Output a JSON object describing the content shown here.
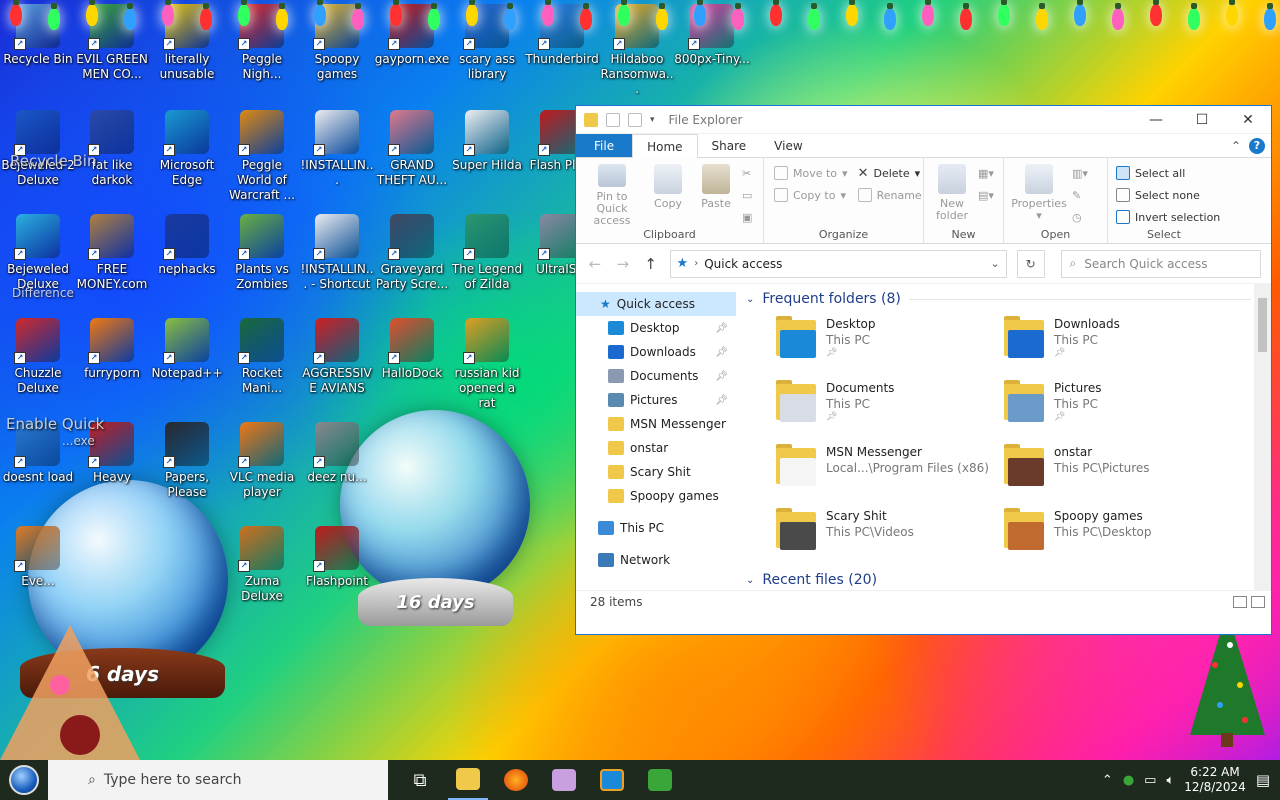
{
  "desktop": {
    "icons_row1": [
      {
        "label": "Recycle Bin",
        "color": "#5aa0e0"
      },
      {
        "label": "EVIL GREEN MEN CO...",
        "color": "#3aa63a"
      },
      {
        "label": "literally unusable",
        "color": "#e8c20a"
      },
      {
        "label": "Peggle Nigh...",
        "color": "#e02a2a"
      },
      {
        "label": "Spoopy games",
        "color": "#e6b830"
      },
      {
        "label": "gayporn.exe",
        "color": "#c81a1a"
      },
      {
        "label": "scary ass library",
        "color": "#2a6ad0"
      },
      {
        "label": "Thunderbird",
        "color": "#2f7fe0"
      },
      {
        "label": "Hildaboo Ransomwa...",
        "color": "#f0b020"
      },
      {
        "label": "800px-Tiny...",
        "color": "#e040a0"
      }
    ],
    "icons_row2": [
      {
        "label": "Bejeweled 2 Deluxe",
        "color": "#1a58c8"
      },
      {
        "label": "fat like darkok",
        "color": "#2a4aa8"
      },
      {
        "label": "Microsoft Edge",
        "color": "#1a9ad0"
      },
      {
        "label": "Peggle World of Warcraft ...",
        "color": "#e08a10"
      },
      {
        "label": "!INSTALLIN...",
        "color": "#eeeeee"
      },
      {
        "label": "GRAND THEFT AU...",
        "color": "#e07a8a"
      },
      {
        "label": "Super Hilda",
        "color": "#f0f0f0"
      },
      {
        "label": "Flash Pla...",
        "color": "#c01a1a"
      }
    ],
    "icons_row3": [
      {
        "label": "Bejeweled Deluxe",
        "color": "#2ab0e0"
      },
      {
        "label": "FREE MONEY.com",
        "color": "#b08040"
      },
      {
        "label": "nephacks",
        "color": "#1a3aa0"
      },
      {
        "label": "Plants vs Zombies",
        "color": "#6ab040"
      },
      {
        "label": "!INSTALLIN... - Shortcut",
        "color": "#eeeeee"
      },
      {
        "label": "Graveyard Party Scre...",
        "color": "#404a60"
      },
      {
        "label": "The Legend of Zilda",
        "color": "#2a9a6a"
      },
      {
        "label": "UltraIS...",
        "color": "#8a8aa0"
      }
    ],
    "icons_row4": [
      {
        "label": "Chuzzle Deluxe",
        "color": "#d02a2a"
      },
      {
        "label": "furryporn",
        "color": "#f07a10"
      },
      {
        "label": "Notepad++",
        "color": "#8ac040"
      },
      {
        "label": "Rocket Mani...",
        "color": "#1a6a3a"
      },
      {
        "label": "AGGRESSIVE AVIANS",
        "color": "#d02020"
      },
      {
        "label": "HalloDock",
        "color": "#e0502a"
      },
      {
        "label": "russian kid opened a rat",
        "color": "#e0a020"
      }
    ],
    "icons_row5": [
      {
        "label": "doesnt load",
        "color": "#2a7ad0"
      },
      {
        "label": "Heavy",
        "color": "#c02020"
      },
      {
        "label": "Papers, Please",
        "color": "#2a2a2a"
      },
      {
        "label": "VLC media player",
        "color": "#f07a10"
      },
      {
        "label": "deez nu...",
        "color": "#8a8a8a"
      }
    ],
    "icons_row6": [
      {
        "label": "Eve...",
        "color": "#e07a20"
      },
      {
        "label": "Zuma Deluxe",
        "color": "#d0701a"
      },
      {
        "label": "Flashpoint",
        "color": "#c01a1a"
      }
    ],
    "globe_small_text": "16 days",
    "globe_large_text": "6 days",
    "overlay_texts": [
      "Recycle Bin",
      "Enable Quick",
      "Difference",
      "...exe"
    ]
  },
  "explorer": {
    "title": "File Explorer",
    "tabs": {
      "file": "File",
      "home": "Home",
      "share": "Share",
      "view": "View"
    },
    "ribbon": {
      "clipboard": {
        "pin": "Pin to Quick access",
        "copy": "Copy",
        "paste": "Paste",
        "group": "Clipboard"
      },
      "organize": {
        "move_to": "Move to",
        "copy_to": "Copy to",
        "delete": "Delete",
        "rename": "Rename",
        "group": "Organize"
      },
      "new": {
        "new_folder": "New folder",
        "group": "New"
      },
      "open": {
        "properties": "Properties",
        "group": "Open"
      },
      "select": {
        "select_all": "Select all",
        "select_none": "Select none",
        "invert": "Invert selection",
        "group": "Select"
      }
    },
    "address": "Quick access",
    "search_placeholder": "Search Quick access",
    "nav": {
      "quick_access": "Quick access",
      "items": [
        {
          "label": "Desktop",
          "pinned": true,
          "color": "#1a8ad8"
        },
        {
          "label": "Downloads",
          "pinned": true,
          "color": "#1a6ad0"
        },
        {
          "label": "Documents",
          "pinned": true,
          "color": "#8a9ab0"
        },
        {
          "label": "Pictures",
          "pinned": true,
          "color": "#5a8ab0"
        },
        {
          "label": "MSN Messenger",
          "pinned": false,
          "color": "#f0c94a"
        },
        {
          "label": "onstar",
          "pinned": false,
          "color": "#f0c94a"
        },
        {
          "label": "Scary Shit",
          "pinned": false,
          "color": "#f0c94a"
        },
        {
          "label": "Spoopy games",
          "pinned": false,
          "color": "#f0c94a"
        }
      ],
      "this_pc": "This PC",
      "network": "Network"
    },
    "frequent_header": "Frequent folders (8)",
    "recent_header": "Recent files (20)",
    "frequent": [
      {
        "name": "Desktop",
        "location": "This PC",
        "pinned": true,
        "front": "#1a8ad8"
      },
      {
        "name": "Downloads",
        "location": "This PC",
        "pinned": true,
        "front": "#1a6ad0"
      },
      {
        "name": "Documents",
        "location": "This PC",
        "pinned": true,
        "front": "#d8dde5"
      },
      {
        "name": "Pictures",
        "location": "This PC",
        "pinned": true,
        "front": "#6a9ac8"
      },
      {
        "name": "MSN Messenger",
        "location": "Local...\\Program Files (x86)",
        "pinned": false,
        "front": "#f5f5f5"
      },
      {
        "name": "onstar",
        "location": "This PC\\Pictures",
        "pinned": false,
        "front": "#6a3a2a"
      },
      {
        "name": "Scary Shit",
        "location": "This PC\\Videos",
        "pinned": false,
        "front": "#4a4a4a"
      },
      {
        "name": "Spoopy games",
        "location": "This PC\\Desktop",
        "pinned": false,
        "front": "#c06a30"
      }
    ],
    "status": "28 items"
  },
  "taskbar": {
    "search_text": "Type here to search",
    "time": "6:22 AM",
    "date": "12/8/2024"
  }
}
